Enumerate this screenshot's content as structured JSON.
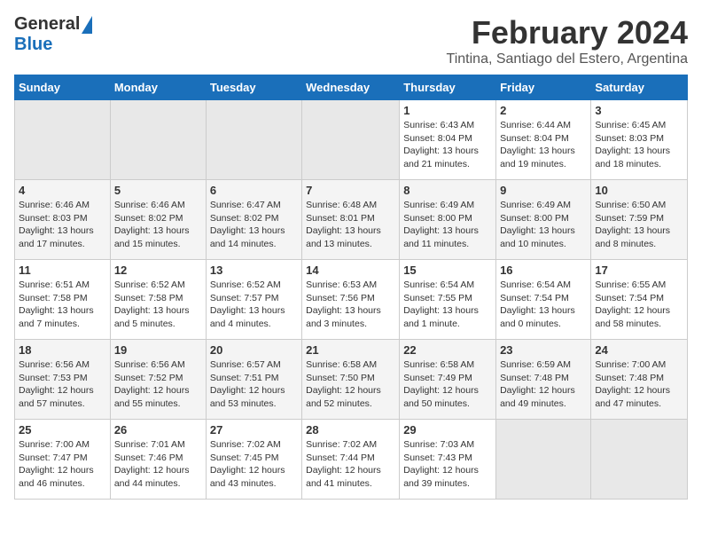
{
  "logo": {
    "general": "General",
    "blue": "Blue"
  },
  "title": "February 2024",
  "subtitle": "Tintina, Santiago del Estero, Argentina",
  "days_header": [
    "Sunday",
    "Monday",
    "Tuesday",
    "Wednesday",
    "Thursday",
    "Friday",
    "Saturday"
  ],
  "weeks": [
    [
      {
        "day": "",
        "info": ""
      },
      {
        "day": "",
        "info": ""
      },
      {
        "day": "",
        "info": ""
      },
      {
        "day": "",
        "info": ""
      },
      {
        "day": "1",
        "info": "Sunrise: 6:43 AM\nSunset: 8:04 PM\nDaylight: 13 hours\nand 21 minutes."
      },
      {
        "day": "2",
        "info": "Sunrise: 6:44 AM\nSunset: 8:04 PM\nDaylight: 13 hours\nand 19 minutes."
      },
      {
        "day": "3",
        "info": "Sunrise: 6:45 AM\nSunset: 8:03 PM\nDaylight: 13 hours\nand 18 minutes."
      }
    ],
    [
      {
        "day": "4",
        "info": "Sunrise: 6:46 AM\nSunset: 8:03 PM\nDaylight: 13 hours\nand 17 minutes."
      },
      {
        "day": "5",
        "info": "Sunrise: 6:46 AM\nSunset: 8:02 PM\nDaylight: 13 hours\nand 15 minutes."
      },
      {
        "day": "6",
        "info": "Sunrise: 6:47 AM\nSunset: 8:02 PM\nDaylight: 13 hours\nand 14 minutes."
      },
      {
        "day": "7",
        "info": "Sunrise: 6:48 AM\nSunset: 8:01 PM\nDaylight: 13 hours\nand 13 minutes."
      },
      {
        "day": "8",
        "info": "Sunrise: 6:49 AM\nSunset: 8:00 PM\nDaylight: 13 hours\nand 11 minutes."
      },
      {
        "day": "9",
        "info": "Sunrise: 6:49 AM\nSunset: 8:00 PM\nDaylight: 13 hours\nand 10 minutes."
      },
      {
        "day": "10",
        "info": "Sunrise: 6:50 AM\nSunset: 7:59 PM\nDaylight: 13 hours\nand 8 minutes."
      }
    ],
    [
      {
        "day": "11",
        "info": "Sunrise: 6:51 AM\nSunset: 7:58 PM\nDaylight: 13 hours\nand 7 minutes."
      },
      {
        "day": "12",
        "info": "Sunrise: 6:52 AM\nSunset: 7:58 PM\nDaylight: 13 hours\nand 5 minutes."
      },
      {
        "day": "13",
        "info": "Sunrise: 6:52 AM\nSunset: 7:57 PM\nDaylight: 13 hours\nand 4 minutes."
      },
      {
        "day": "14",
        "info": "Sunrise: 6:53 AM\nSunset: 7:56 PM\nDaylight: 13 hours\nand 3 minutes."
      },
      {
        "day": "15",
        "info": "Sunrise: 6:54 AM\nSunset: 7:55 PM\nDaylight: 13 hours\nand 1 minute."
      },
      {
        "day": "16",
        "info": "Sunrise: 6:54 AM\nSunset: 7:54 PM\nDaylight: 13 hours\nand 0 minutes."
      },
      {
        "day": "17",
        "info": "Sunrise: 6:55 AM\nSunset: 7:54 PM\nDaylight: 12 hours\nand 58 minutes."
      }
    ],
    [
      {
        "day": "18",
        "info": "Sunrise: 6:56 AM\nSunset: 7:53 PM\nDaylight: 12 hours\nand 57 minutes."
      },
      {
        "day": "19",
        "info": "Sunrise: 6:56 AM\nSunset: 7:52 PM\nDaylight: 12 hours\nand 55 minutes."
      },
      {
        "day": "20",
        "info": "Sunrise: 6:57 AM\nSunset: 7:51 PM\nDaylight: 12 hours\nand 53 minutes."
      },
      {
        "day": "21",
        "info": "Sunrise: 6:58 AM\nSunset: 7:50 PM\nDaylight: 12 hours\nand 52 minutes."
      },
      {
        "day": "22",
        "info": "Sunrise: 6:58 AM\nSunset: 7:49 PM\nDaylight: 12 hours\nand 50 minutes."
      },
      {
        "day": "23",
        "info": "Sunrise: 6:59 AM\nSunset: 7:48 PM\nDaylight: 12 hours\nand 49 minutes."
      },
      {
        "day": "24",
        "info": "Sunrise: 7:00 AM\nSunset: 7:48 PM\nDaylight: 12 hours\nand 47 minutes."
      }
    ],
    [
      {
        "day": "25",
        "info": "Sunrise: 7:00 AM\nSunset: 7:47 PM\nDaylight: 12 hours\nand 46 minutes."
      },
      {
        "day": "26",
        "info": "Sunrise: 7:01 AM\nSunset: 7:46 PM\nDaylight: 12 hours\nand 44 minutes."
      },
      {
        "day": "27",
        "info": "Sunrise: 7:02 AM\nSunset: 7:45 PM\nDaylight: 12 hours\nand 43 minutes."
      },
      {
        "day": "28",
        "info": "Sunrise: 7:02 AM\nSunset: 7:44 PM\nDaylight: 12 hours\nand 41 minutes."
      },
      {
        "day": "29",
        "info": "Sunrise: 7:03 AM\nSunset: 7:43 PM\nDaylight: 12 hours\nand 39 minutes."
      },
      {
        "day": "",
        "info": ""
      },
      {
        "day": "",
        "info": ""
      }
    ]
  ]
}
